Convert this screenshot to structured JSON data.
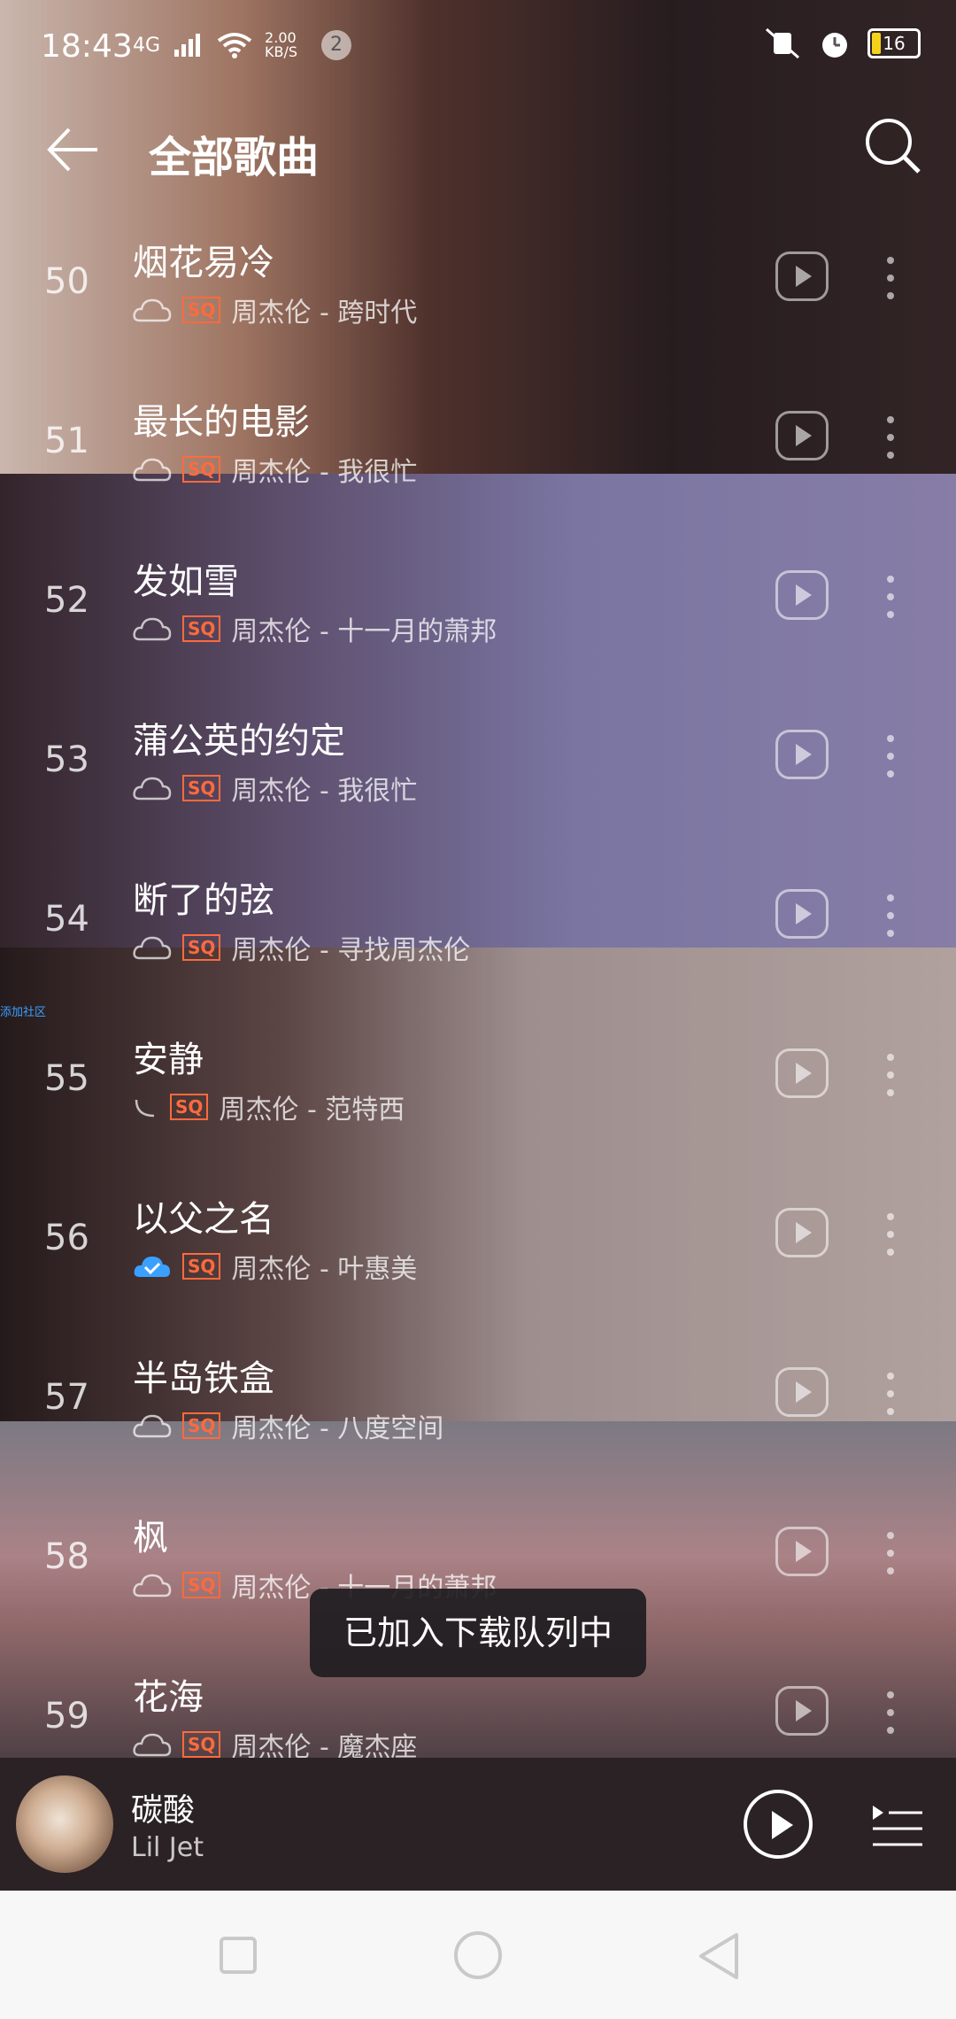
{
  "status_bar": {
    "time": "18:43",
    "network": "4G",
    "speed": "2.00 KB/S",
    "notification_count": "2",
    "battery": "16"
  },
  "header": {
    "title": "全部歌曲",
    "back_icon": "back-arrow-icon",
    "search_icon": "search-icon"
  },
  "songs": [
    {
      "index": "50",
      "name": "烟花易冷",
      "badge": "SQ",
      "meta": "周杰伦 - 跨时代",
      "status_icon": "cloud-icon"
    },
    {
      "index": "51",
      "name": "最长的电影",
      "badge": "SQ",
      "meta": "周杰伦 - 我很忙",
      "status_icon": "cloud-icon"
    },
    {
      "index": "52",
      "name": "发如雪",
      "badge": "SQ",
      "meta": "周杰伦 - 十一月的萧邦",
      "status_icon": "cloud-icon"
    },
    {
      "index": "53",
      "name": "蒲公英的约定",
      "badge": "SQ",
      "meta": "周杰伦 - 我很忙",
      "status_icon": "cloud-icon"
    },
    {
      "index": "54",
      "name": "断了的弦",
      "badge": "SQ",
      "meta": "周杰伦 - 寻找周杰伦",
      "status_icon": "cloud-icon"
    },
    {
      "index": "55",
      "name": "安静",
      "badge": "SQ",
      "meta": "周杰伦 - 范特西",
      "status_icon": "loading-icon"
    },
    {
      "index": "56",
      "name": "以父之名",
      "badge": "SQ",
      "meta": "周杰伦 - 叶惠美",
      "status_icon": "cloud-check-icon"
    },
    {
      "index": "57",
      "name": "半岛铁盒",
      "badge": "SQ",
      "meta": "周杰伦 - 八度空间",
      "status_icon": "cloud-icon"
    },
    {
      "index": "58",
      "name": "枫",
      "badge": "SQ",
      "meta": "周杰伦 - 十一月的萧邦",
      "status_icon": "cloud-icon"
    },
    {
      "index": "59",
      "name": "花海",
      "badge": "SQ",
      "meta": "周杰伦 - 魔杰座",
      "status_icon": "cloud-icon"
    }
  ],
  "small_label": "添加社区",
  "toast": "已加入下载队列中",
  "player": {
    "track_title": "碳酸",
    "track_artist": "Lil Jet"
  },
  "colors": {
    "sq_badge": "#ff6a3d",
    "download_check": "#3aa0ff"
  }
}
